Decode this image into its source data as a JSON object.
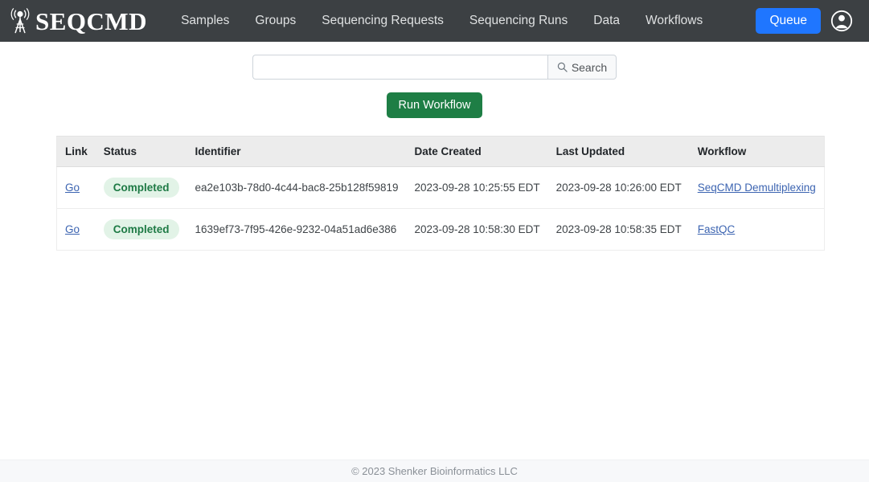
{
  "navbar": {
    "brand": {
      "text": "SEQCMD",
      "icon": "broadcast-tower-icon"
    },
    "links": [
      {
        "label": "Samples"
      },
      {
        "label": "Groups"
      },
      {
        "label": "Sequencing Requests"
      },
      {
        "label": "Sequencing Runs"
      },
      {
        "label": "Data"
      },
      {
        "label": "Workflows"
      }
    ],
    "queue_label": "Queue",
    "queue_color": "#1f76ff",
    "account_icon": "account-circle-icon"
  },
  "search": {
    "value": "",
    "placeholder": "",
    "button_label": "Search",
    "button_icon": "search-icon"
  },
  "actions": {
    "run_workflow_label": "Run Workflow",
    "run_workflow_color": "#1e7e45"
  },
  "table": {
    "headers": [
      "Link",
      "Status",
      "Identifier",
      "Date Created",
      "Last Updated",
      "Workflow"
    ],
    "rows": [
      {
        "link": "Go",
        "status": "Completed",
        "identifier": "ea2e103b-78d0-4c44-bac8-25b128f59819",
        "date_created": "2023-09-28 10:25:55 EDT",
        "last_updated": "2023-09-28 10:26:00 EDT",
        "workflow": "SeqCMD Demultiplexing"
      },
      {
        "link": "Go",
        "status": "Completed",
        "identifier": "1639ef73-7f95-426e-9232-04a51ad6e386",
        "date_created": "2023-09-28 10:58:30 EDT",
        "last_updated": "2023-09-28 10:58:35 EDT",
        "workflow": "FastQC"
      }
    ],
    "status_badge_bg": "#e2f3e7",
    "status_badge_color": "#1e7a45"
  },
  "footer": {
    "text": "© 2023 Shenker Bioinformatics LLC"
  }
}
